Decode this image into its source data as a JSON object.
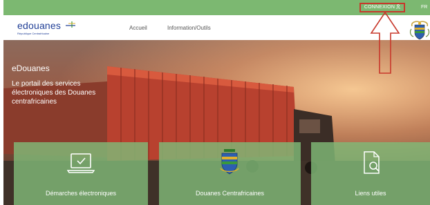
{
  "topbar": {
    "login_label": "CONNEXION",
    "user_icon": "user-icon",
    "language": "FR"
  },
  "nav": {
    "logo_text": "edouanes",
    "logo_subtitle": "République Centrafricaine",
    "links": [
      "Accueil",
      "Information/Outils"
    ]
  },
  "hero": {
    "title": "eDouanes",
    "subtitle": "Le portail des services électroniques des Douanes centrafricaines"
  },
  "tiles": [
    {
      "label": "Démarches électroniques",
      "icon": "laptop-check-icon"
    },
    {
      "label": "Douanes Centrafricaines",
      "icon": "customs-emblem-icon"
    },
    {
      "label": "Liens utiles",
      "icon": "document-search-icon"
    }
  ],
  "colors": {
    "topbar": "#7cb871",
    "tile": "#80ba78",
    "logo_blue": "#1f3e96",
    "annotation_red": "#c8382b"
  }
}
